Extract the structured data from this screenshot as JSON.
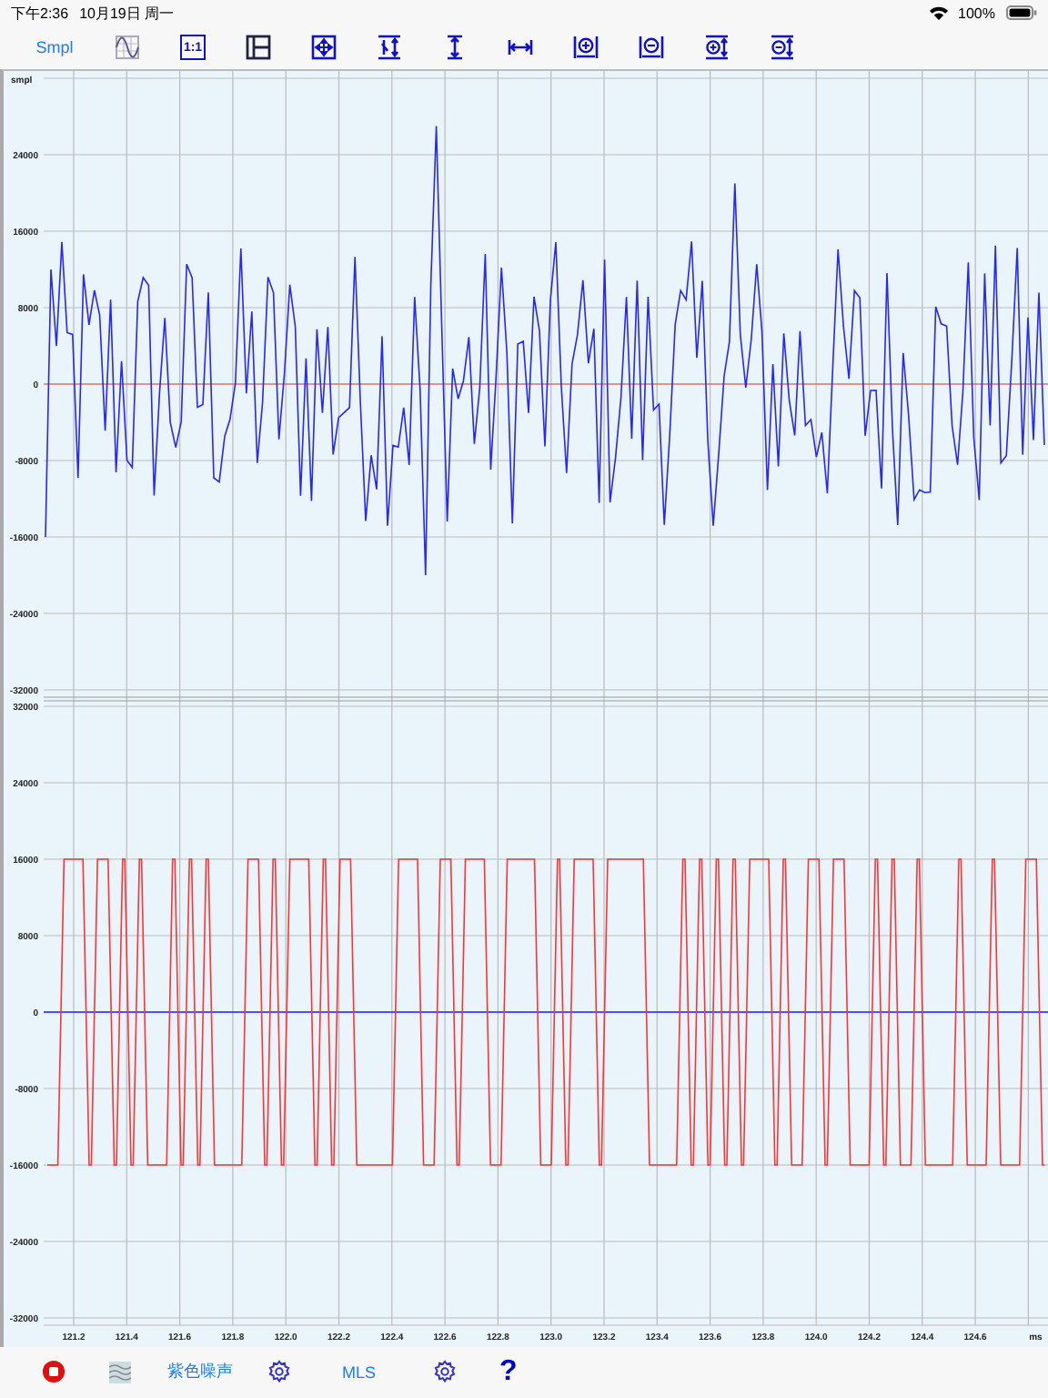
{
  "status_bar": {
    "time": "下午2:36",
    "date": "10月19日 周一",
    "battery": "100%"
  },
  "toolbar": {
    "mode_button": "Smpl",
    "ratio_label": "1:1"
  },
  "top_panel": {
    "unit": "smpl",
    "y_labels": [
      "24000",
      "16000",
      "8000",
      "0",
      "-8000",
      "-16000",
      "-24000",
      "-32000"
    ]
  },
  "bottom_panel": {
    "y_labels": [
      "32000",
      "24000",
      "16000",
      "8000",
      "0",
      "-8000",
      "-16000",
      "-24000",
      "-32000"
    ]
  },
  "x_axis": {
    "labels": [
      "121.2",
      "121.4",
      "121.6",
      "121.8",
      "122.0",
      "122.2",
      "122.4",
      "122.6",
      "122.8",
      "123.0",
      "123.2",
      "123.4",
      "123.6",
      "123.8",
      "124.0",
      "124.2",
      "124.4",
      "124.6"
    ],
    "unit": "ms"
  },
  "bottom_toolbar": {
    "noise_label": "紫色噪声",
    "signal_label": "MLS",
    "help": "?"
  }
}
